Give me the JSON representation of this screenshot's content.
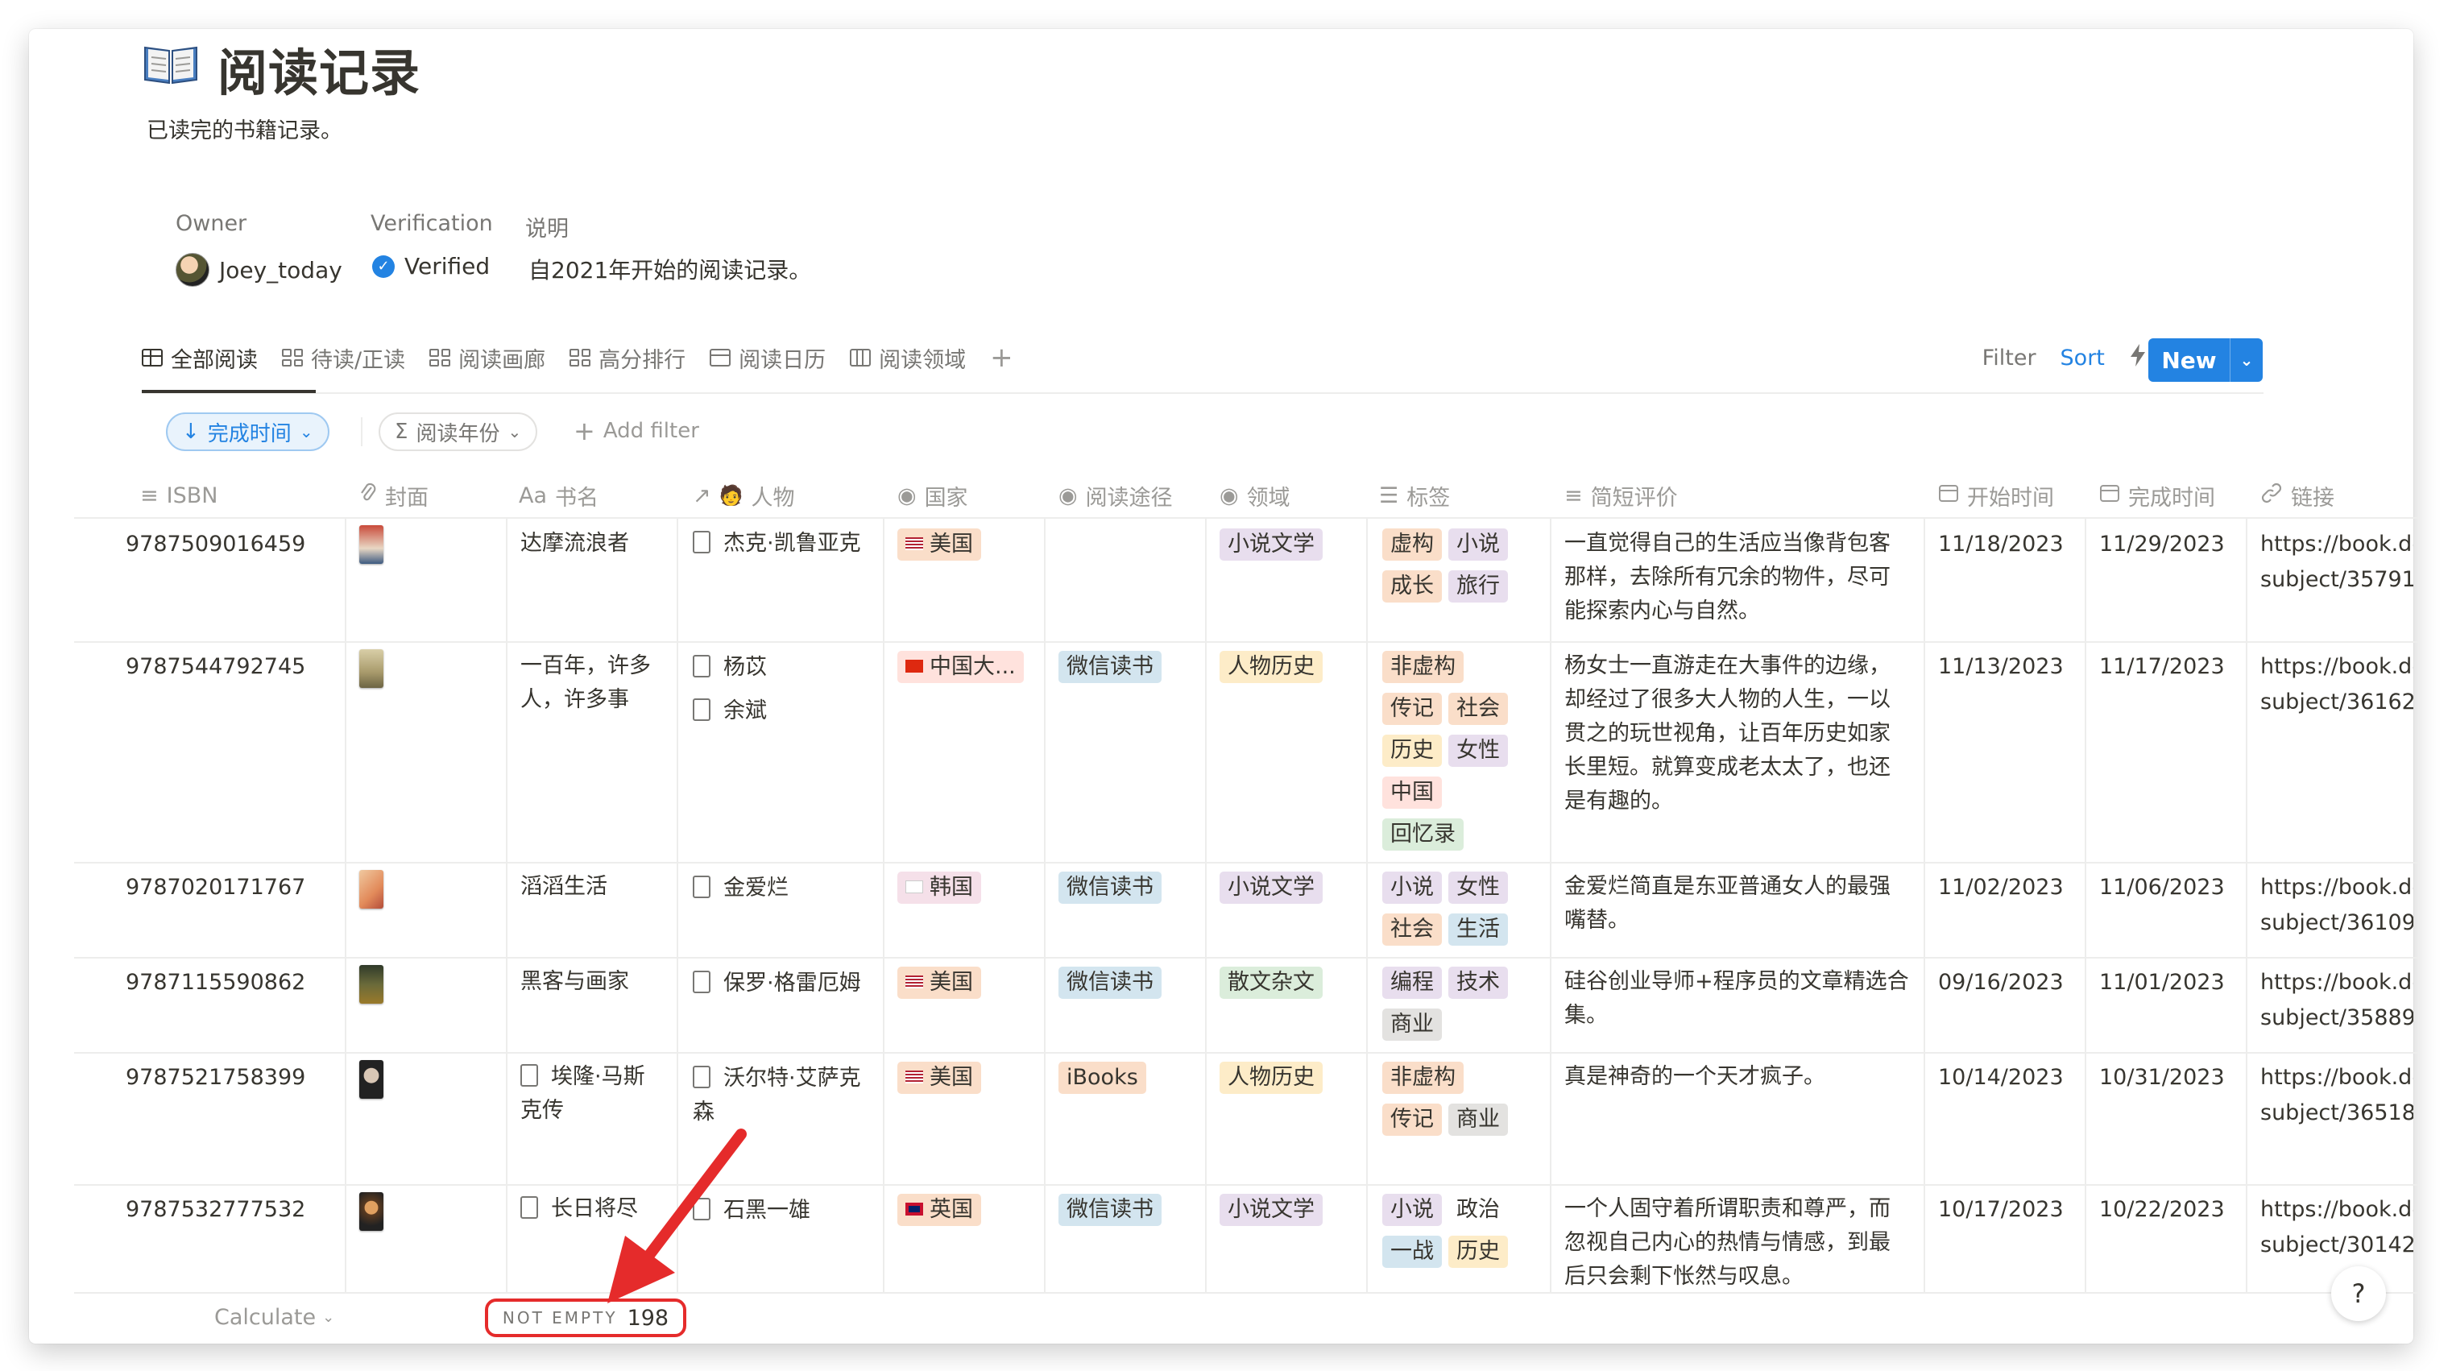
{
  "page": {
    "icon": "open-book-icon",
    "title": "阅读记录",
    "description": "已读完的书籍记录。"
  },
  "properties": {
    "owner_label": "Owner",
    "owner_value": "Joey_today",
    "verification_label": "Verification",
    "verification_value": "Verified",
    "note_label": "说明",
    "note_value": "自2021年开始的阅读记录。"
  },
  "views": [
    "全部阅读",
    "待读/正读",
    "阅读画廊",
    "高分排行",
    "阅读日历",
    "阅读领域"
  ],
  "view_add": "+",
  "toolbar": {
    "filter": "Filter",
    "sort": "Sort",
    "new": "New",
    "accent": "#2383e2"
  },
  "filters": {
    "sort_pill": "完成时间",
    "group_pill": "阅读年份",
    "add_filter": "Add filter"
  },
  "columns": [
    "ISBN",
    "封面",
    "书名",
    "人物",
    "国家",
    "阅读途径",
    "领域",
    "标签",
    "简短评价",
    "开始时间",
    "完成时间",
    "链接"
  ],
  "column_icons": {
    "isbn_icon": "≡",
    "cover_icon": "paperclip-icon",
    "title_icon": "Aa",
    "person_icon": "↗",
    "country_icon": "◉",
    "channel_icon": "◉",
    "domain_icon": "◉",
    "tags_icon": "☰",
    "review_icon": "≡",
    "link_icon": "link-icon"
  },
  "rows": [
    {
      "isbn": "9787509016459",
      "title": "达摩流浪者",
      "title_is_page": false,
      "people": [
        "杰克·凯鲁亚克"
      ],
      "country": "美国",
      "channel": "",
      "domain": "小说文学",
      "tags": [
        "虚构",
        "小说",
        "成长",
        "旅行"
      ],
      "review": "一直觉得自己的生活应当像背包客那样，去除所有冗余的物件，尽可能探索内心与自然。",
      "start": "11/18/2023",
      "end": "11/29/2023",
      "link1": "https://book.dc",
      "link2": "subject/35791"
    },
    {
      "isbn": "9787544792745",
      "title": "一百年，许多人，许多事",
      "title_is_page": false,
      "people": [
        "杨苡",
        "余斌"
      ],
      "country": "中国大...",
      "channel": "微信读书",
      "domain": "人物历史",
      "tags": [
        "非虚构",
        "传记",
        "社会",
        "历史",
        "女性",
        "中国",
        "回忆录"
      ],
      "review": "杨女士一直游走在大事件的边缘，却经过了很多大人物的人生，一以贯之的玩世视角，让百年历史如家长里短。就算变成老太太了，也还是有趣的。",
      "start": "11/13/2023",
      "end": "11/17/2023",
      "link1": "https://book.dc",
      "link2": "subject/36162"
    },
    {
      "isbn": "9787020171767",
      "title": "滔滔生活",
      "title_is_page": false,
      "people": [
        "金爱烂"
      ],
      "country": "韩国",
      "channel": "微信读书",
      "domain": "小说文学",
      "tags": [
        "小说",
        "女性",
        "社会",
        "生活"
      ],
      "review": "金爱烂简直是东亚普通女人的最强嘴替。",
      "start": "11/02/2023",
      "end": "11/06/2023",
      "link1": "https://book.dc",
      "link2": "subject/36109"
    },
    {
      "isbn": "9787115590862",
      "title": "黑客与画家",
      "title_is_page": false,
      "people": [
        "保罗·格雷厄姆"
      ],
      "country": "美国",
      "channel": "微信读书",
      "domain": "散文杂文",
      "tags": [
        "编程",
        "技术",
        "商业"
      ],
      "review": "硅谷创业导师+程序员的文章精选合集。",
      "start": "09/16/2023",
      "end": "11/01/2023",
      "link1": "https://book.dc",
      "link2": "subject/35889"
    },
    {
      "isbn": "9787521758399",
      "title": "埃隆·马斯克传",
      "title_is_page": true,
      "people": [
        "沃尔特·艾萨克森"
      ],
      "country": "美国",
      "channel": "iBooks",
      "domain": "人物历史",
      "tags": [
        "非虚构",
        "传记",
        "商业"
      ],
      "review": "真是神奇的一个天才疯子。",
      "start": "10/14/2023",
      "end": "10/31/2023",
      "link1": "https://book.dc",
      "link2": "subject/36518"
    },
    {
      "isbn": "9787532777532",
      "title": "长日将尽",
      "title_is_page": true,
      "people": [
        "石黑一雄"
      ],
      "country": "英国",
      "channel": "微信读书",
      "domain": "小说文学",
      "tags": [
        "小说",
        "政治",
        "一战",
        "历史"
      ],
      "review": "一个人固守着所谓职责和尊严，而忽视自己内心的热情与情感，到最后只会剩下怅然与叹息。",
      "start": "10/17/2023",
      "end": "10/22/2023",
      "link1": "https://book.dc",
      "link2": "subject/30142"
    }
  ],
  "footer": {
    "calculate": "Calculate",
    "not_empty_label": "NOT EMPTY",
    "not_empty_count": "198"
  },
  "help": "?",
  "annotation": {
    "arrow_color": "#e52b2b"
  }
}
